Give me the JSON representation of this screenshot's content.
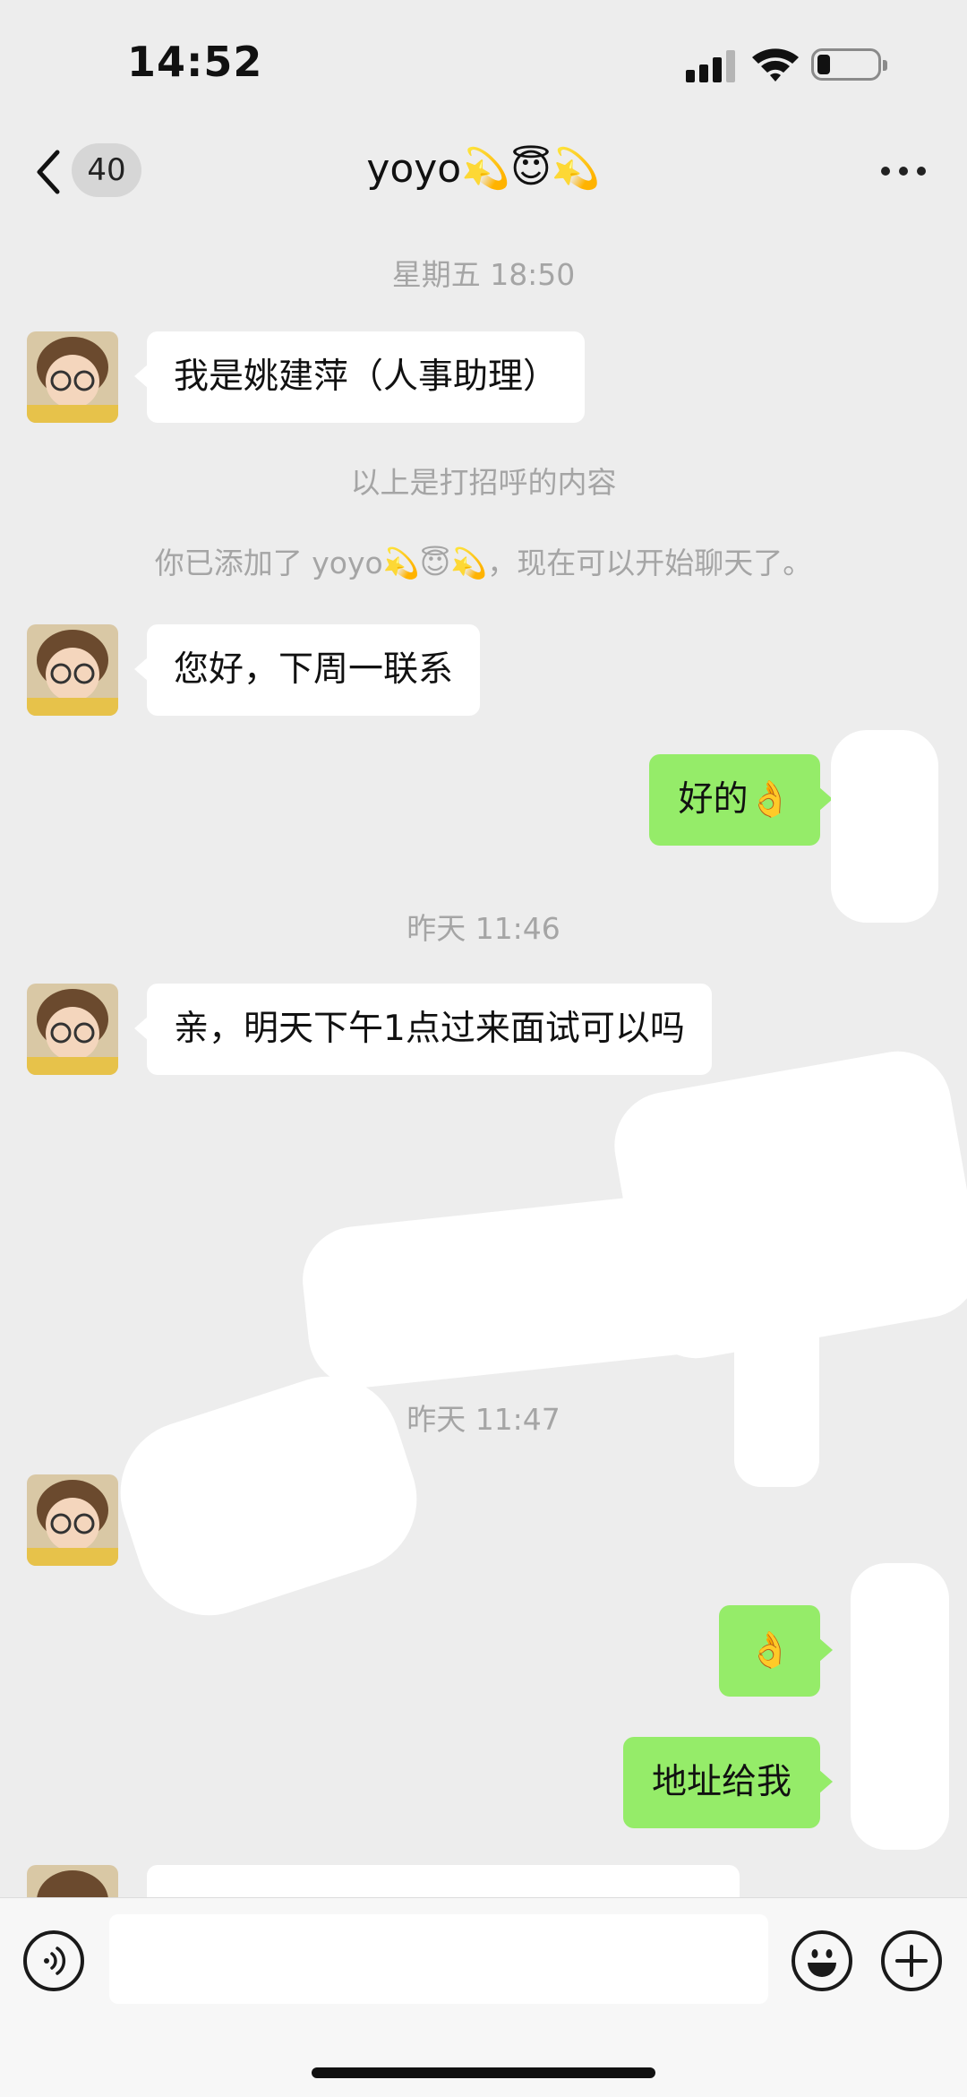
{
  "status_bar": {
    "time": "14:52"
  },
  "nav": {
    "unread_count": "40",
    "title": "yoyo💫😇💫"
  },
  "messages": [
    {
      "type": "time",
      "text": "星期五 18:50"
    },
    {
      "type": "incoming",
      "text": "我是姚建萍（人事助理）"
    },
    {
      "type": "system",
      "text": "以上是打招呼的内容"
    },
    {
      "type": "system",
      "text": "你已添加了 yoyo💫😇💫，现在可以开始聊天了。"
    },
    {
      "type": "incoming",
      "text": "您好，下周一联系"
    },
    {
      "type": "outgoing",
      "text": "好的👌"
    },
    {
      "type": "time",
      "text": "昨天 11:46"
    },
    {
      "type": "incoming",
      "text": "亲，明天下午1点过来面试可以吗"
    },
    {
      "type": "time",
      "text": "昨天 11:47"
    },
    {
      "type": "outgoing",
      "text": "👌"
    },
    {
      "type": "outgoing",
      "text": "地址给我"
    }
  ],
  "input": {
    "placeholder": ""
  },
  "icons": {
    "back": "chevron-left-icon",
    "more": "more-dots-icon",
    "voice": "voice-icon",
    "emoji": "emoji-icon",
    "plus": "plus-icon"
  },
  "colors": {
    "outgoing_bubble": "#95ec69",
    "incoming_bubble": "#ffffff",
    "background": "#ededed"
  }
}
